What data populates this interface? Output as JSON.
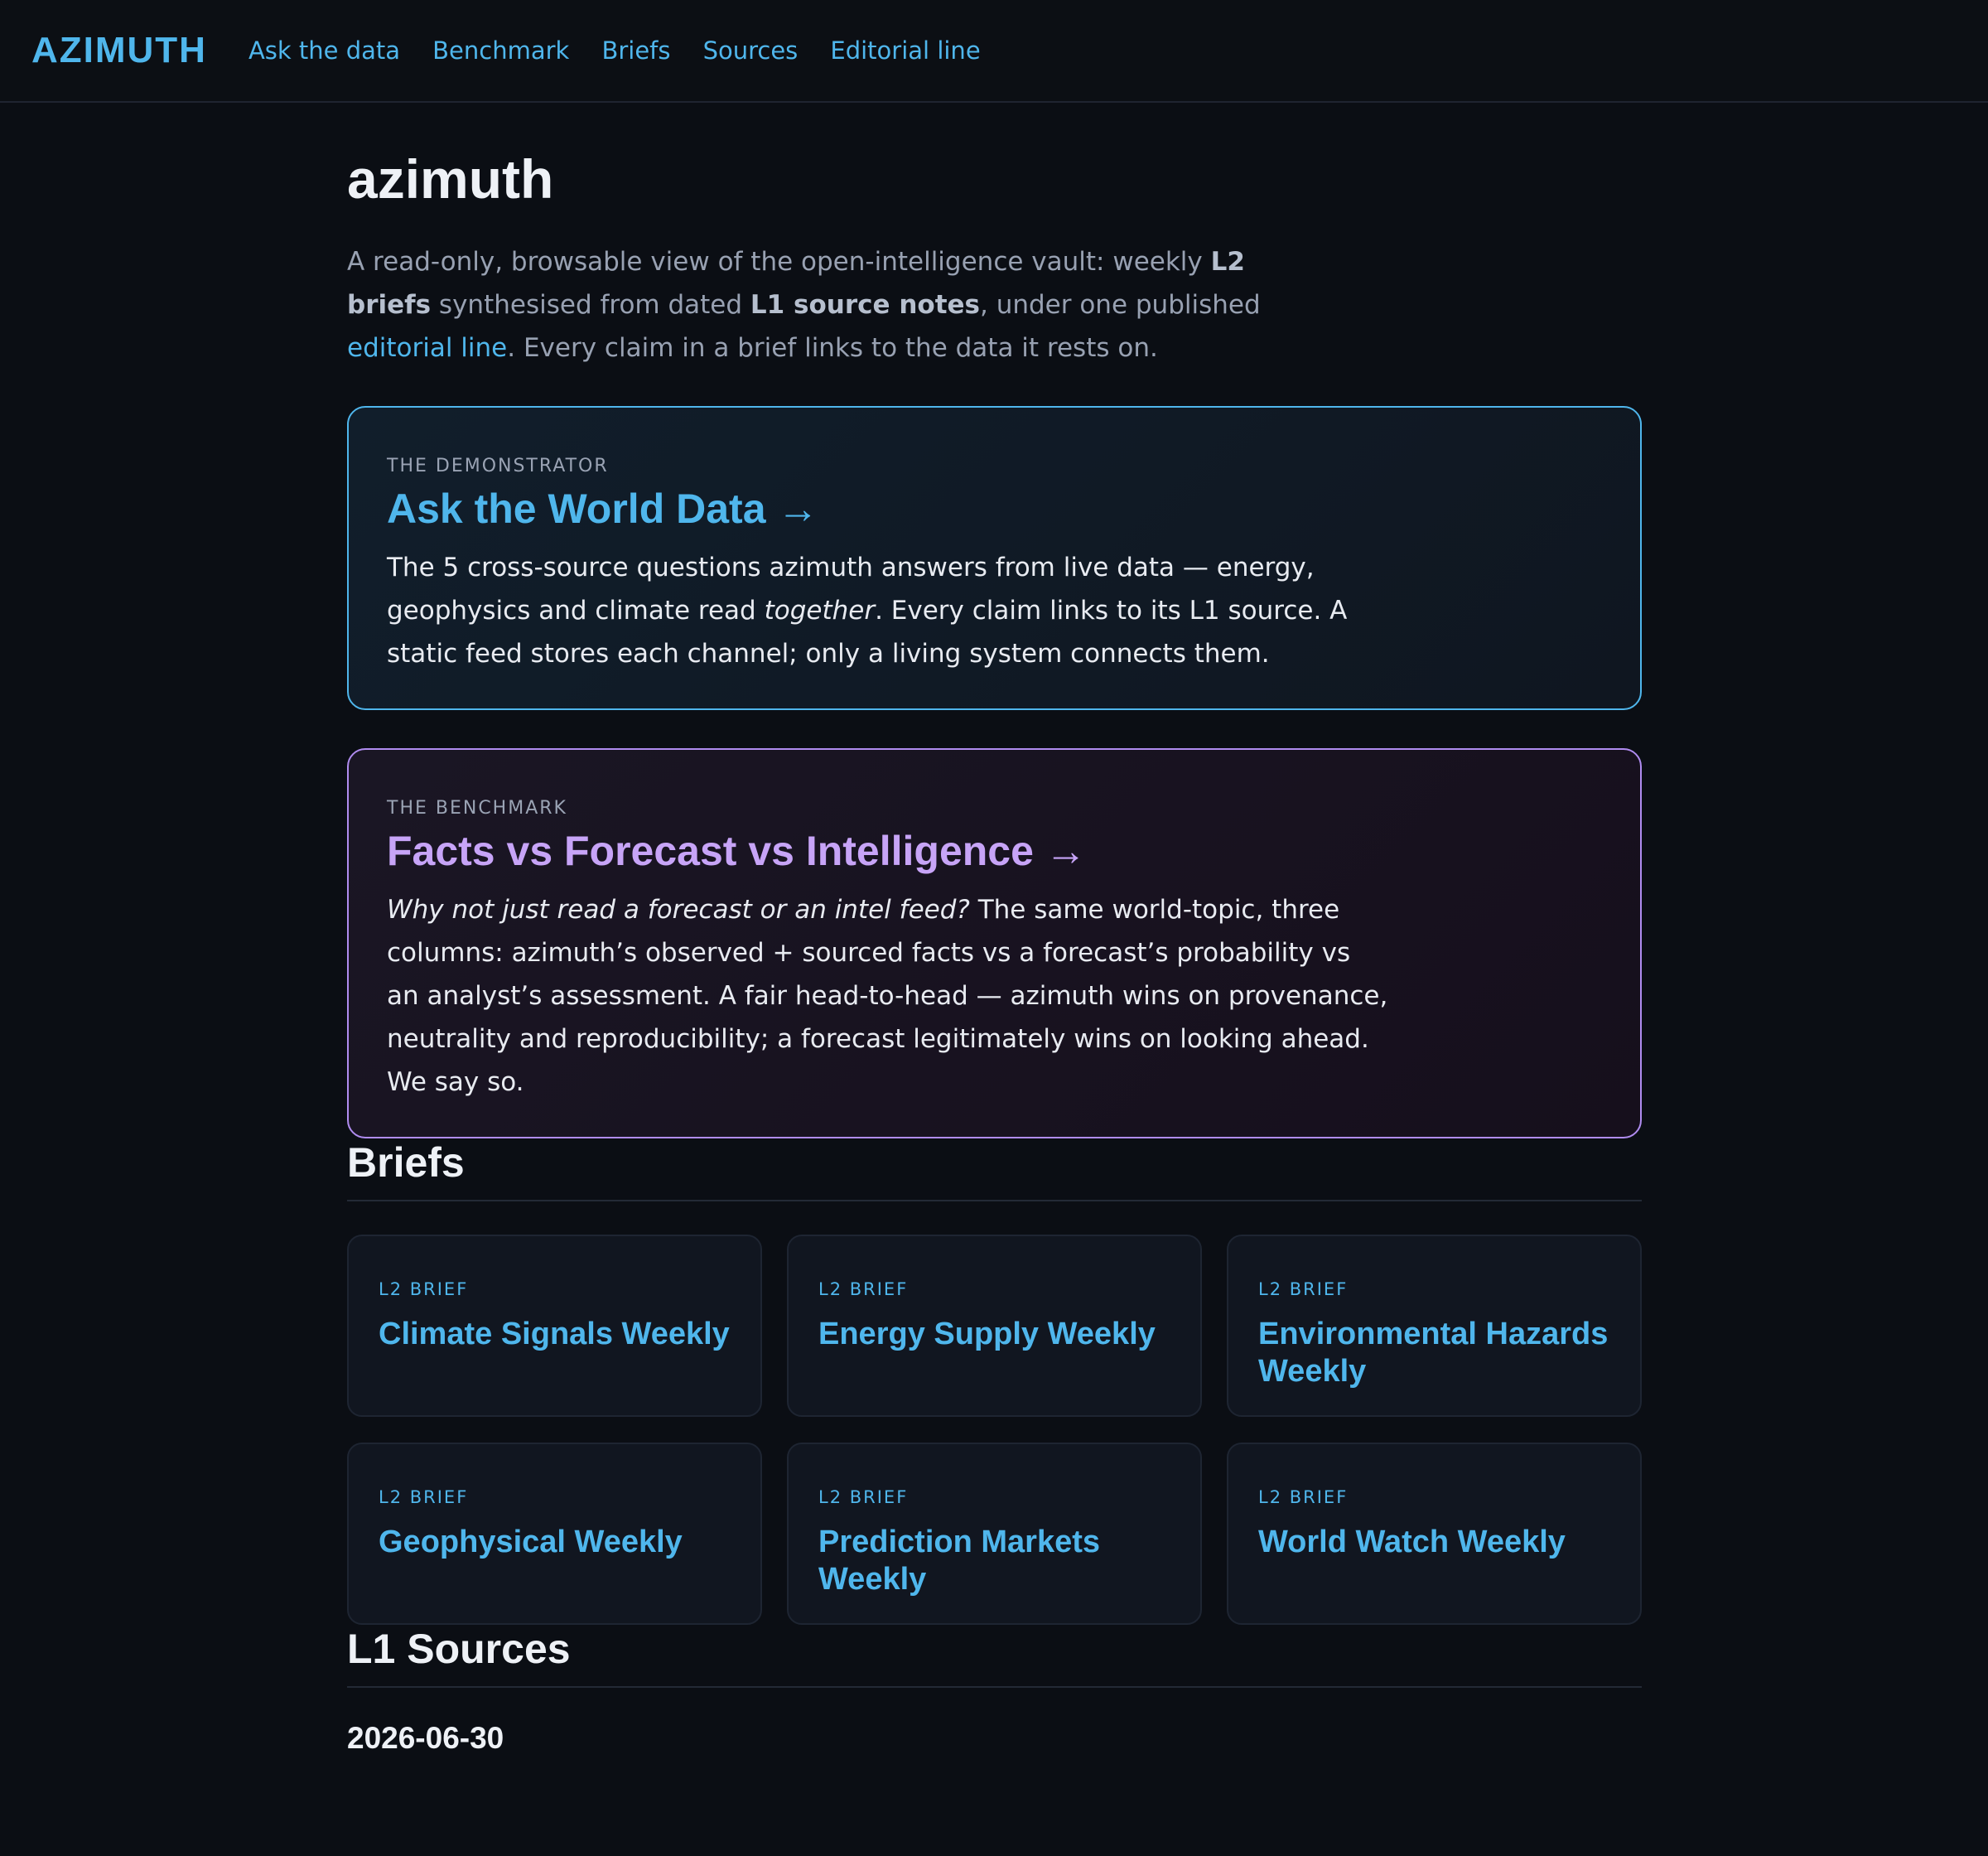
{
  "nav": {
    "brand": "AZIMUTH",
    "links": [
      "Ask the data",
      "Benchmark",
      "Briefs",
      "Sources",
      "Editorial line"
    ]
  },
  "page": {
    "title": "azimuth",
    "intro": {
      "p1": "A read-only, browsable view of the open-intelligence vault: weekly ",
      "b1": "L2 briefs",
      "p2": " synthesised from dated ",
      "b2": "L1 source notes",
      "p3": ", under one published ",
      "link": "editorial line",
      "p4": ". Every claim in a brief links to the data it rests on."
    }
  },
  "demonstrator": {
    "eyebrow": "THE DEMONSTRATOR",
    "title": "Ask the World Data →",
    "body1": "The 5 cross-source questions azimuth answers from live data — energy, geophysics and climate read ",
    "body_em": "together",
    "body2": ". Every claim links to its L1 source. A static feed stores each channel; only a living system connects them."
  },
  "benchmark": {
    "eyebrow": "THE BENCHMARK",
    "title": "Facts vs Forecast vs Intelligence →",
    "body_em": "Why not just read a forecast or an intel feed?",
    "body": " The same world-topic, three columns: azimuth’s observed + sourced facts vs a forecast’s probability vs an analyst’s assessment. A fair head-to-head — azimuth wins on provenance, neutrality and reproducibility; a forecast legitimately wins on looking ahead. We say so."
  },
  "briefs": {
    "heading": "Briefs",
    "tag": "L2 BRIEF",
    "items": [
      "Climate Signals Weekly",
      "Energy Supply Weekly",
      "Environmental Hazards Weekly",
      "Geophysical Weekly",
      "Prediction Markets Weekly",
      "World Watch Weekly"
    ]
  },
  "sources": {
    "heading": "L1 Sources",
    "date": "2026-06-30"
  }
}
